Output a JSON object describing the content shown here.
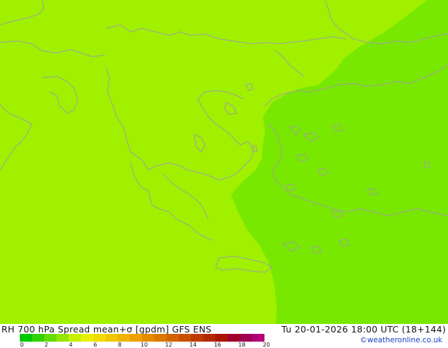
{
  "header": {
    "title": "RH 700 hPa Spread mean+σ [gpdm] GFS ENS",
    "valid_time": "Tu 20-01-2026 18:00 UTC (18+144)",
    "credit": "©weatheronline.co.uk"
  },
  "colors": {
    "field_low": "#a0f000",
    "field_high": "#78e800",
    "coastline": "#a0a0a0"
  },
  "legend": {
    "ticks": [
      "0",
      "2",
      "4",
      "6",
      "8",
      "10",
      "12",
      "14",
      "16",
      "18",
      "20"
    ],
    "colors": [
      "#00c800",
      "#32d200",
      "#64dc00",
      "#96e600",
      "#c8f000",
      "#e6f000",
      "#f0dc00",
      "#f0c800",
      "#f0b400",
      "#f0a000",
      "#e68c00",
      "#dc7800",
      "#d26400",
      "#c85000",
      "#be3c00",
      "#b42800",
      "#aa1400",
      "#a00028",
      "#a00050",
      "#b40078"
    ]
  }
}
